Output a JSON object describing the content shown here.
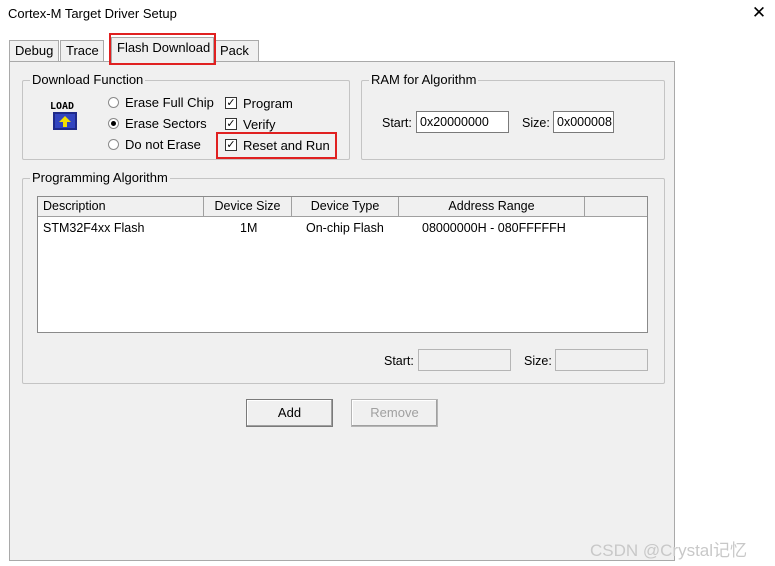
{
  "window": {
    "title": "Cortex-M Target Driver Setup",
    "close_glyph": "✕"
  },
  "tabs": [
    {
      "label": "Debug"
    },
    {
      "label": "Trace"
    },
    {
      "label": "Flash Download",
      "active": true
    },
    {
      "label": "Pack"
    }
  ],
  "download_function": {
    "label": "Download Function",
    "icon_text": "LOAD",
    "erase_options": [
      {
        "label": "Erase Full Chip",
        "selected": false
      },
      {
        "label": "Erase Sectors",
        "selected": true
      },
      {
        "label": "Do not Erase",
        "selected": false
      }
    ],
    "checks": [
      {
        "label": "Program",
        "checked": true
      },
      {
        "label": "Verify",
        "checked": true
      },
      {
        "label": "Reset and Run",
        "checked": true
      }
    ],
    "check_glyph": "✓"
  },
  "ram": {
    "label": "RAM for Algorithm",
    "start_label": "Start:",
    "start_value": "0x20000000",
    "size_label": "Size:",
    "size_value": "0x000008"
  },
  "programming_algorithm": {
    "label": "Programming Algorithm",
    "columns": [
      "Description",
      "Device Size",
      "Device Type",
      "Address Range"
    ],
    "rows": [
      {
        "description": "STM32F4xx Flash",
        "device_size": "1M",
        "device_type": "On-chip Flash",
        "address_range": "08000000H - 080FFFFFH"
      }
    ],
    "start_label": "Start:",
    "start_value": "",
    "size_label": "Size:",
    "size_value": ""
  },
  "buttons": {
    "add": "Add",
    "remove": "Remove"
  },
  "watermark": "CSDN @Crystal记忆",
  "colors": {
    "highlight": "#e02020",
    "panel": "#f0f0f0"
  }
}
